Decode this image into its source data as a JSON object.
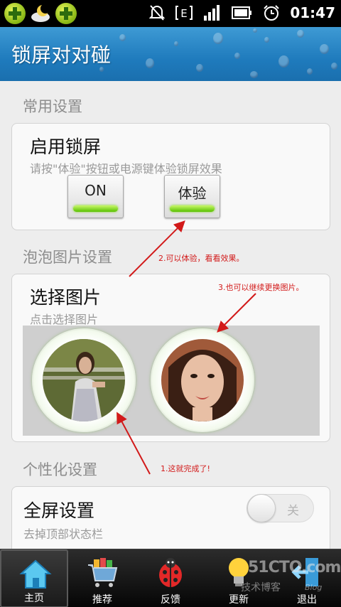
{
  "status_bar": {
    "time": "01:47",
    "network_type": "E",
    "icons": [
      "app-plus-icon",
      "weather-moon-icon",
      "app-plus-icon",
      "mute-icon",
      "signal-icon",
      "battery-icon",
      "alarm-icon"
    ]
  },
  "header": {
    "title": "锁屏对对碰"
  },
  "sections": {
    "common": "常用设置",
    "bubble": "泡泡图片设置",
    "personal": "个性化设置"
  },
  "lock_card": {
    "title": "启用锁屏",
    "subtitle": "请按\"体验\"按钮或电源键体验锁屏效果",
    "on_button": "ON",
    "try_button": "体验"
  },
  "picture_card": {
    "title": "选择图片",
    "subtitle": "点击选择图片"
  },
  "fullscreen_card": {
    "title": "全屏设置",
    "subtitle": "去掉顶部状态栏",
    "toggle_label": "关"
  },
  "annotations": {
    "note1": "1.这就完成了!",
    "note2": "2.可以体验，看看效果。",
    "note3": "3.也可以继续更换图片。"
  },
  "bottom_nav": {
    "items": [
      {
        "label": "主页",
        "icon": "home-icon",
        "active": true
      },
      {
        "label": "推荐",
        "icon": "cart-icon",
        "active": false
      },
      {
        "label": "反馈",
        "icon": "ladybug-icon",
        "active": false
      },
      {
        "label": "更新",
        "icon": "lightbulb-icon",
        "active": false
      },
      {
        "label": "退出",
        "icon": "exit-icon",
        "active": false
      }
    ]
  },
  "watermark": {
    "site": "51CTO.com",
    "tagline": "技术博客",
    "blog": "Blog"
  },
  "colors": {
    "header_blue": "#1f7bbd",
    "led_green": "#58c000",
    "annotation_red": "#d21a1a",
    "nav_bg": "#050505"
  }
}
